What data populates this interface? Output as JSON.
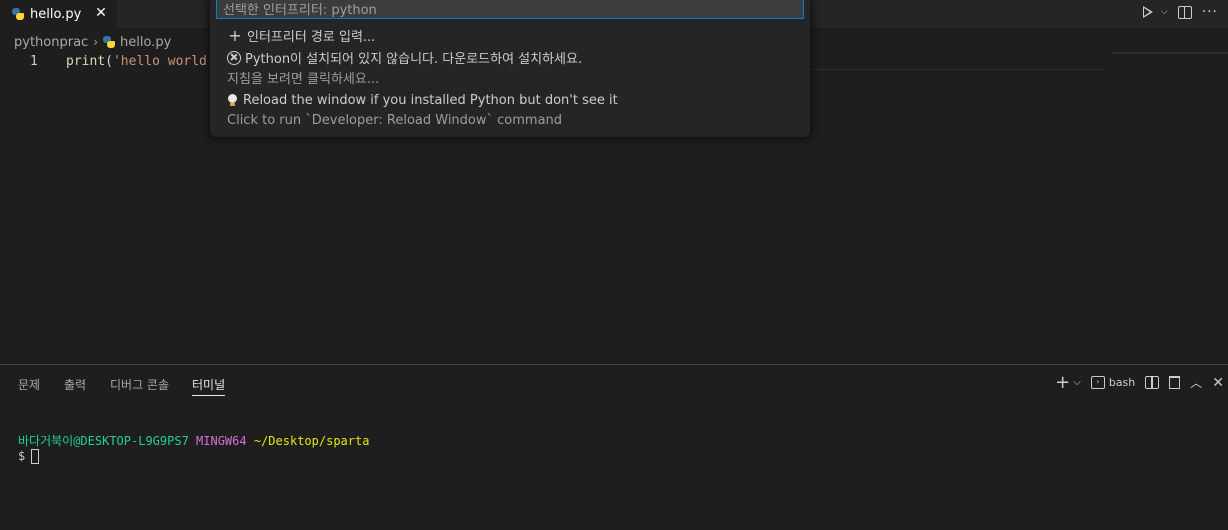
{
  "tab": {
    "label": "hello.py",
    "close": "✕"
  },
  "breadcrumb": {
    "folder": "pythonprac",
    "separator": "›",
    "file": "hello.py"
  },
  "editor": {
    "line_number": "1",
    "code": {
      "fn": "print",
      "open": "(",
      "str": "'hello world'",
      "close": ")"
    }
  },
  "quickpick": {
    "input_value": "선택한 인터프리터: python",
    "items": [
      {
        "icon": "plus-icon",
        "label": "인터프리터 경로 입력..."
      },
      {
        "icon": "error-circle-icon",
        "label": "Python이 설치되어 있지 않습니다. 다운로드하여 설치하세요.",
        "detail": "지침을 보려면 클릭하세요..."
      },
      {
        "icon": "lightbulb-icon",
        "label": "Reload the window if you installed Python but don't see it",
        "detail": "Click to run `Developer: Reload Window` command"
      }
    ]
  },
  "panel": {
    "tabs": [
      "문제",
      "출력",
      "디버그 콘솔",
      "터미널"
    ],
    "active_tab": "터미널",
    "terminal_name": "bash"
  },
  "terminal": {
    "user": "바다거북이@DESKTOP-L9G9PS7",
    "system": "MINGW64",
    "path": "~/Desktop/sparta",
    "prompt": "$"
  },
  "colors": {
    "accent": "#007fd4",
    "term_user": "#23d18b",
    "term_system": "#d670d6",
    "term_path": "#e5e510"
  }
}
